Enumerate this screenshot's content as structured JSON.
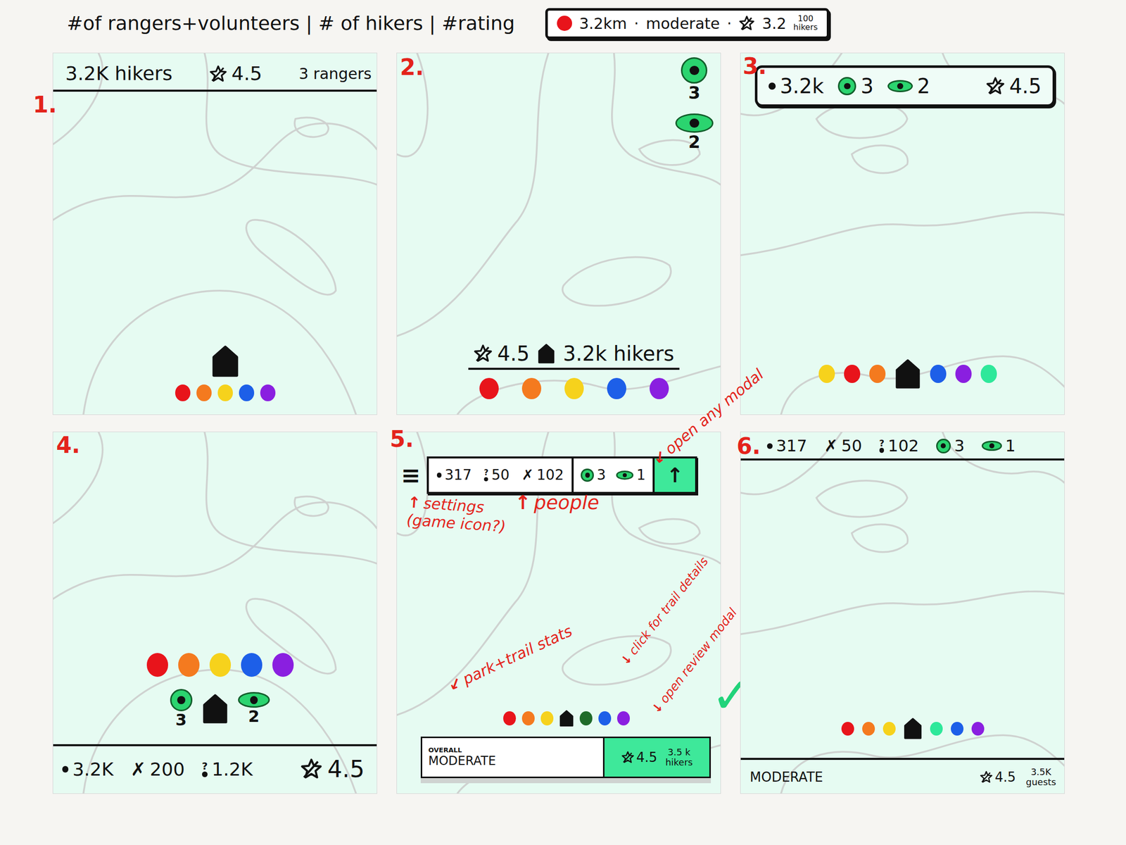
{
  "header": {
    "title": "#of rangers+volunteers | # of hikers | #rating",
    "legend": {
      "color": "#e8141b",
      "distance": "3.2km",
      "sep1": "·",
      "difficulty": "moderate",
      "sep2": "·",
      "rating": "3.2",
      "hikers_count": "100",
      "hikers_label": "hikers"
    }
  },
  "panels": [
    {
      "label": "1.",
      "kind": "top-bar",
      "top": [
        {
          "kind": "label",
          "value": "3.2K hikers"
        },
        {
          "kind": "rating",
          "value": "4.5"
        },
        {
          "kind": "label",
          "value": "3 rangers"
        }
      ],
      "pin_rows": [
        [
          {
            "kind": "home"
          }
        ],
        [
          {
            "kind": "dot",
            "color": "#e8141b"
          },
          {
            "kind": "dot",
            "color": "#f47a1f"
          },
          {
            "kind": "dot",
            "color": "#f6d21c"
          },
          {
            "kind": "dot",
            "color": "#1d5fe8"
          },
          {
            "kind": "dot",
            "color": "#8a1fe0"
          }
        ]
      ]
    },
    {
      "label": "2.",
      "kind": "side-badges",
      "badges": [
        {
          "kind": "ranger",
          "count": "3"
        },
        {
          "kind": "volunteer",
          "count": "2"
        }
      ],
      "bottom": [
        {
          "kind": "rating",
          "value": "4.5"
        },
        {
          "kind": "home"
        },
        {
          "kind": "label",
          "value": "3.2k hikers"
        }
      ],
      "pin_rows": [
        [
          {
            "kind": "dot",
            "color": "#e8141b"
          },
          {
            "kind": "dot",
            "color": "#f47a1f"
          },
          {
            "kind": "dot",
            "color": "#f6d21c"
          },
          {
            "kind": "dot",
            "color": "#1d5fe8"
          },
          {
            "kind": "dot",
            "color": "#8a1fe0"
          }
        ]
      ]
    },
    {
      "label": "3.",
      "kind": "top-pill",
      "top": [
        {
          "kind": "hikers",
          "value": "3.2k"
        },
        {
          "kind": "ranger",
          "value": "3"
        },
        {
          "kind": "volunteer",
          "value": "2"
        },
        {
          "kind": "rating",
          "value": "4.5"
        }
      ],
      "pin_rows": [
        [
          {
            "kind": "dot",
            "color": "#f6d21c"
          },
          {
            "kind": "dot",
            "color": "#e8141b"
          },
          {
            "kind": "dot",
            "color": "#f47a1f"
          },
          {
            "kind": "home"
          },
          {
            "kind": "dot",
            "color": "#1d5fe8"
          },
          {
            "kind": "dot",
            "color": "#8a1fe0"
          },
          {
            "kind": "dot",
            "color": "#2ee89a"
          }
        ]
      ]
    },
    {
      "label": "4.",
      "kind": "bottom-bar",
      "pin_rows": [
        [
          {
            "kind": "dot",
            "color": "#e8141b"
          },
          {
            "kind": "dot",
            "color": "#f47a1f"
          },
          {
            "kind": "dot",
            "color": "#f6d21c"
          },
          {
            "kind": "dot",
            "color": "#1d5fe8"
          },
          {
            "kind": "dot",
            "color": "#8a1fe0"
          }
        ],
        [
          {
            "kind": "ranger",
            "count": "3"
          },
          {
            "kind": "home"
          },
          {
            "kind": "volunteer",
            "count": "2"
          }
        ]
      ],
      "bottom": [
        {
          "kind": "hikers",
          "value": "3.2K"
        },
        {
          "kind": "x",
          "icon": "✗",
          "value": "200"
        },
        {
          "kind": "question",
          "icon": "?",
          "value": "1.2K"
        },
        {
          "kind": "rating",
          "value": "4.5"
        }
      ]
    },
    {
      "label": "5.",
      "kind": "annotated",
      "menu": "≡",
      "people": [
        {
          "kind": "hikers",
          "value": "317"
        },
        {
          "kind": "question",
          "icon": "?",
          "value": "50"
        },
        {
          "kind": "x",
          "icon": "✗",
          "value": "102"
        }
      ],
      "staff": [
        {
          "kind": "ranger",
          "value": "3"
        },
        {
          "kind": "volunteer",
          "value": "1"
        }
      ],
      "action": "↑",
      "pin_rows": [
        [
          {
            "kind": "dot",
            "color": "#e8141b"
          },
          {
            "kind": "dot",
            "color": "#f47a1f"
          },
          {
            "kind": "dot",
            "color": "#f6d21c"
          },
          {
            "kind": "home"
          },
          {
            "kind": "dot",
            "color": "#1f6b2a"
          },
          {
            "kind": "dot",
            "color": "#1d5fe8"
          },
          {
            "kind": "dot",
            "color": "#8a1fe0"
          }
        ]
      ],
      "summary": {
        "caption": "OVERALL",
        "difficulty": "MODERATE",
        "rating": "4.5",
        "hikers_count": "3.5 k",
        "hikers_label": "hikers"
      },
      "notes": [
        {
          "arrow": "↙",
          "text": "open any modal"
        },
        {
          "arrow": "↑",
          "text": "settings (game icon?)"
        },
        {
          "arrow": "↑",
          "text": "people"
        },
        {
          "arrow": "↙",
          "text": "park+trail stats"
        },
        {
          "arrow": "↓",
          "text": "click for trail details"
        },
        {
          "arrow": "↓",
          "text": "open review modal"
        }
      ],
      "check": "✓"
    },
    {
      "label": "6.",
      "kind": "split-bars",
      "top": [
        {
          "kind": "hikers",
          "value": "317"
        },
        {
          "kind": "x",
          "icon": "✗",
          "value": "50"
        },
        {
          "kind": "question",
          "icon": "?",
          "value": "102"
        },
        {
          "kind": "ranger",
          "value": "3"
        },
        {
          "kind": "volunteer",
          "value": "1"
        }
      ],
      "pin_rows": [
        [
          {
            "kind": "dot",
            "color": "#e8141b"
          },
          {
            "kind": "dot",
            "color": "#f47a1f"
          },
          {
            "kind": "dot",
            "color": "#f6d21c"
          },
          {
            "kind": "home"
          },
          {
            "kind": "dot",
            "color": "#2ee89a"
          },
          {
            "kind": "dot",
            "color": "#1d5fe8"
          },
          {
            "kind": "dot",
            "color": "#8a1fe0"
          }
        ]
      ],
      "summary": {
        "difficulty": "MODERATE",
        "rating": "4.5",
        "guests_count": "3.5K",
        "guests_label": "guests"
      }
    }
  ]
}
